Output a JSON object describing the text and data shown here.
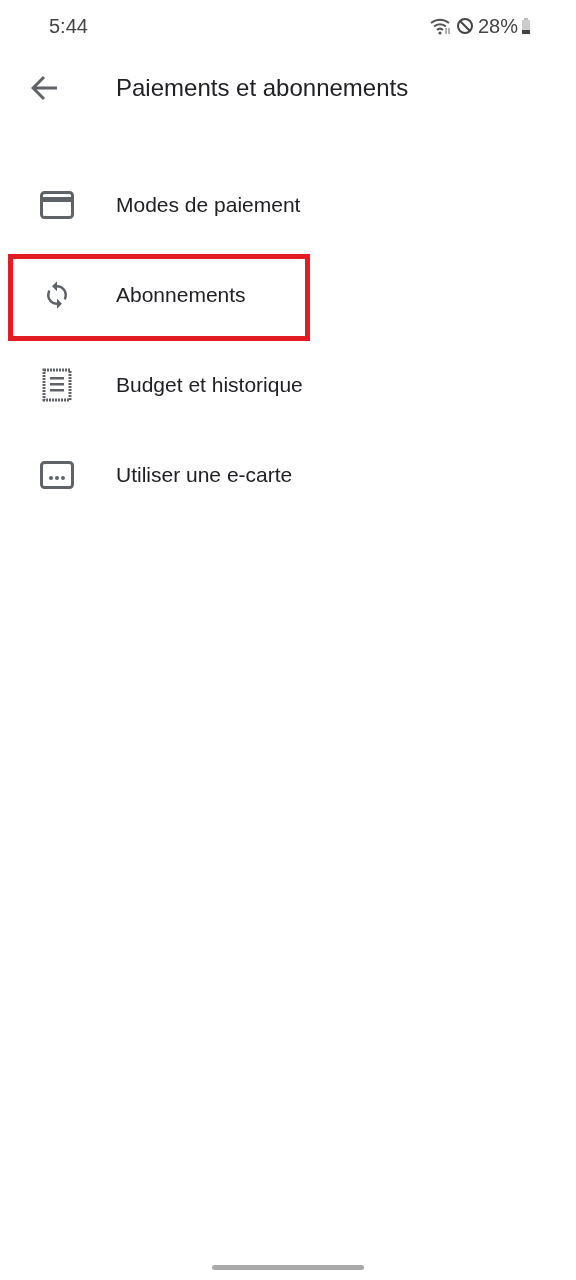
{
  "status_bar": {
    "time": "5:44",
    "battery": "28%"
  },
  "app_bar": {
    "title": "Paiements et abonnements"
  },
  "items": [
    {
      "label": "Modes de paiement",
      "kind": "card",
      "highlighted": false
    },
    {
      "label": "Abonnements",
      "kind": "sync",
      "highlighted": true
    },
    {
      "label": "Budget et historique",
      "kind": "receipt",
      "highlighted": false
    },
    {
      "label": "Utiliser une e-carte",
      "kind": "ecard",
      "highlighted": false
    }
  ]
}
